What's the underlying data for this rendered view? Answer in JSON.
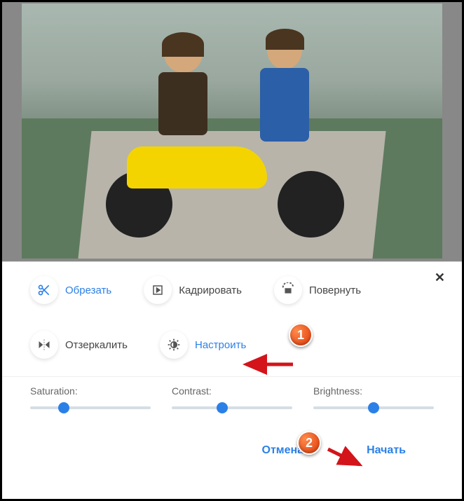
{
  "tools": {
    "trim": "Обрезать",
    "crop": "Кадрировать",
    "rotate": "Повернуть",
    "mirror": "Отзеркалить",
    "adjust": "Настроить"
  },
  "sliders": {
    "saturation": {
      "label": "Saturation:",
      "value": 28
    },
    "contrast": {
      "label": "Contrast:",
      "value": 42
    },
    "brightness": {
      "label": "Brightness:",
      "value": 50
    }
  },
  "actions": {
    "cancel": "Отмена",
    "start": "Начать"
  },
  "annotations": {
    "badge1": "1",
    "badge2": "2"
  },
  "close_glyph": "✕"
}
